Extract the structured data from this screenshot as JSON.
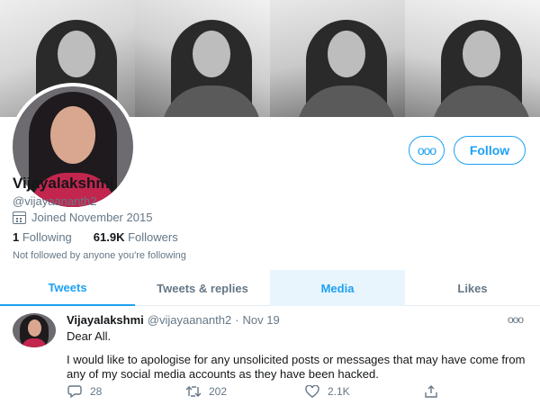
{
  "profile": {
    "name": "Vijayalakshmi",
    "handle": "@vijayaananth2",
    "joined": "Joined November 2015",
    "following_count": "1",
    "following_label": "Following",
    "followers_count": "61.9K",
    "followers_label": "Followers",
    "not_followed": "Not followed by anyone you're following"
  },
  "buttons": {
    "more_glyph": "ooo",
    "follow_label": "Follow"
  },
  "tabs": [
    {
      "label": "Tweets",
      "state": "active"
    },
    {
      "label": "Tweets & replies",
      "state": "normal"
    },
    {
      "label": "Media",
      "state": "hover"
    },
    {
      "label": "Likes",
      "state": "normal"
    }
  ],
  "tweet": {
    "name": "Vijayalakshmi",
    "handle": "@vijayaananth2",
    "separator": "·",
    "date": "Nov 19",
    "greeting": "Dear All.",
    "body": "I would like to apologise for any unsolicited posts or messages that may have come from any of  my social media accounts as they have been hacked.",
    "caret_glyph": "ooo",
    "replies": "28",
    "retweets": "202",
    "likes": "2.1K"
  },
  "icons": {
    "reply": "reply-icon",
    "retweet": "retweet-icon",
    "like": "heart-icon",
    "share": "share-icon",
    "calendar": "calendar-icon"
  },
  "colors": {
    "accent": "#1da1f2",
    "secondary_text": "#657786",
    "tab_hover_bg": "#e8f5fd"
  }
}
